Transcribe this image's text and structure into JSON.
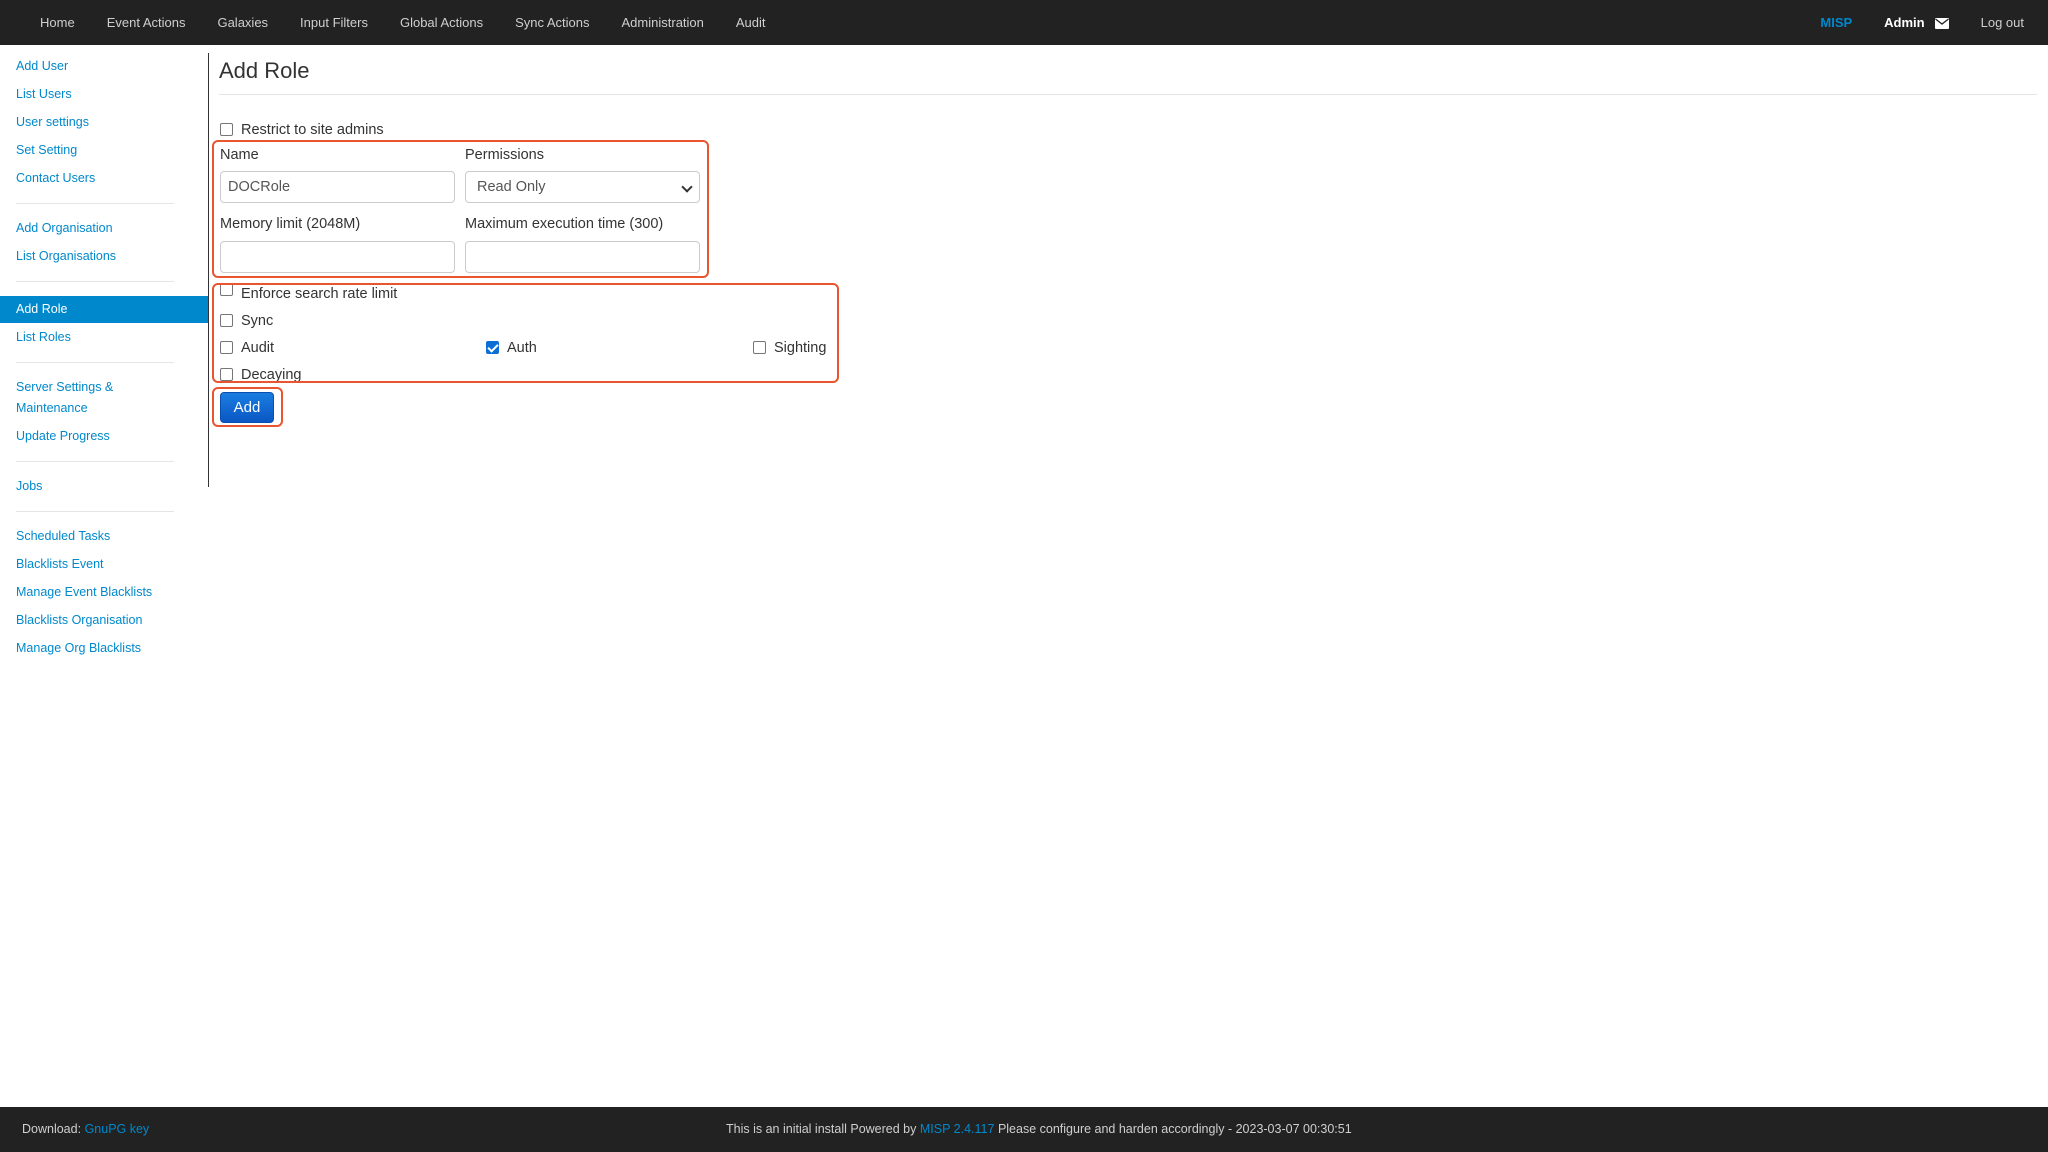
{
  "navbar": {
    "items": [
      "Home",
      "Event Actions",
      "Galaxies",
      "Input Filters",
      "Global Actions",
      "Sync Actions",
      "Administration",
      "Audit"
    ],
    "brand": "MISP",
    "user": "Admin",
    "user_icon": "envelope-icon",
    "logout": "Log out"
  },
  "sidebar": {
    "group1": [
      "Add User",
      "List Users",
      "User settings",
      "Set Setting",
      "Contact Users"
    ],
    "group2": [
      "Add Organisation",
      "List Organisations"
    ],
    "group3": [
      "Add Role",
      "List Roles"
    ],
    "group4": [
      "Server Settings &",
      "Maintenance",
      "Update Progress"
    ],
    "group5": [
      "Jobs"
    ],
    "group6": [
      "Scheduled Tasks",
      "Blacklists Event",
      "Manage Event Blacklists",
      "Blacklists Organisation",
      "Manage Org Blacklists"
    ],
    "active": "Add Role"
  },
  "page": {
    "title": "Add Role"
  },
  "form": {
    "restrict_label": "Restrict to site admins",
    "restrict_checked": false,
    "name_label": "Name",
    "name_value": "DOCRole",
    "permissions_label": "Permissions",
    "permissions_value": "Read Only",
    "memory_label": "Memory limit (2048M)",
    "memory_value": "",
    "max_exec_label": "Maximum execution time (300)",
    "max_exec_value": "",
    "enforce_label": "Enforce search rate limit",
    "enforce_checked": false,
    "sync_label": "Sync",
    "sync_checked": false,
    "audit_label": "Audit",
    "audit_checked": false,
    "auth_label": "Auth",
    "auth_checked": true,
    "sighting_label": "Sighting",
    "sighting_checked": false,
    "decaying_label": "Decaying",
    "decaying_checked": false,
    "submit_label": "Add"
  },
  "footer": {
    "download_prefix": "Download:",
    "gnupg_link": "GnuPG key",
    "center_prefix": "This is an initial install Powered by",
    "misp_link": "MISP 2.4.117",
    "center_suffix": "Please configure and harden accordingly - 2023-03-07 00:30:51"
  },
  "colors": {
    "navbar_bg": "#222222",
    "link": "#0088cc",
    "active_bg": "#0088cc",
    "highlight": "#e8552e",
    "button": "#0b57c4"
  }
}
